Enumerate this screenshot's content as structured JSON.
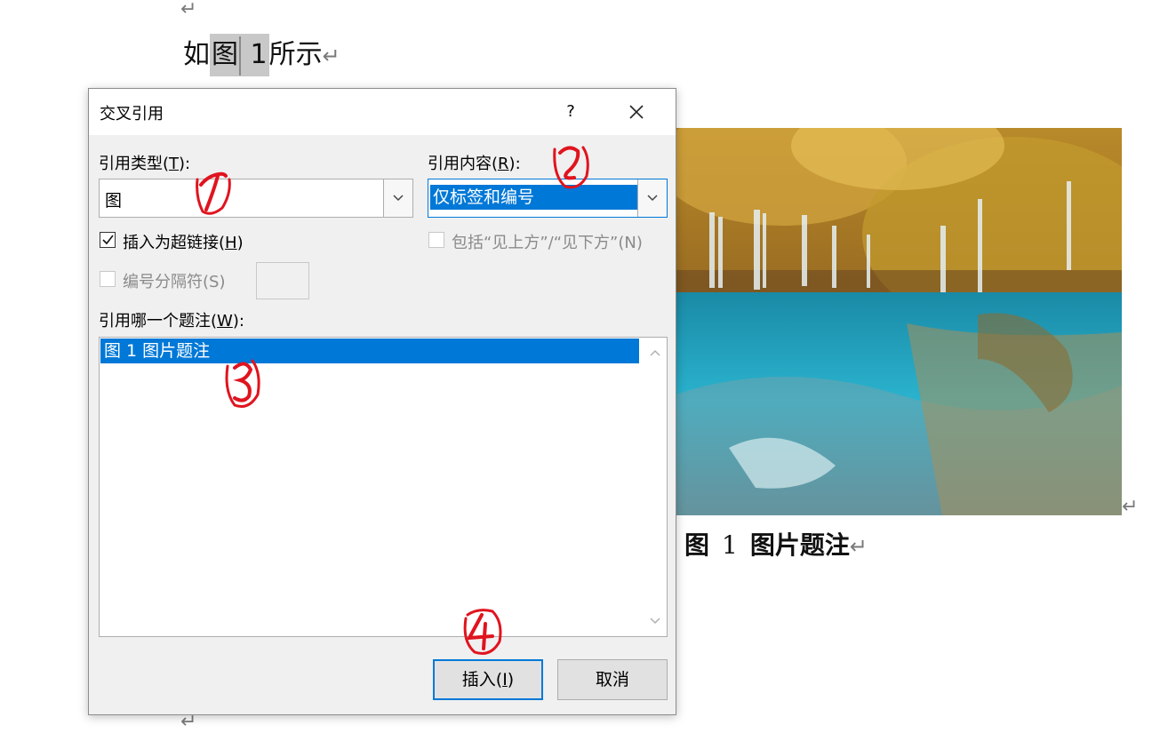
{
  "document": {
    "line_prefix": "如",
    "field_label": "图",
    "field_number": "1",
    "line_suffix": "所示",
    "caption_label": "图",
    "caption_number": "1",
    "caption_text": "图片题注"
  },
  "dialog": {
    "title": "交叉引用",
    "help": "?",
    "reference_type_label": "引用类型(",
    "reference_type_key": "T",
    "reference_type_end": "):",
    "reference_type_value": "图",
    "reference_content_label": "引用内容(",
    "reference_content_key": "R",
    "reference_content_end": "):",
    "reference_content_value": "仅标签和编号",
    "insert_hyperlink_label": "插入为超链接(",
    "insert_hyperlink_key": "H",
    "insert_hyperlink_end": ")",
    "insert_hyperlink_checked": true,
    "include_above_below_label": "包括“见上方”/“见下方”(N)",
    "number_separator_label": "编号分隔符(S)",
    "which_caption_label": "引用哪一个题注(",
    "which_caption_key": "W",
    "which_caption_end": "):",
    "captions": [
      "图 1 图片题注"
    ],
    "insert_button_prefix": "插入(",
    "insert_button_key": "I",
    "insert_button_end": ")",
    "cancel_button": "取消"
  },
  "annotations": [
    "1",
    "2",
    "3",
    "4"
  ],
  "colors": {
    "selection": "#0078d7",
    "annotation": "#e0141e"
  },
  "icons": [
    "paragraph-mark-icon",
    "close-icon",
    "chevron-down-icon",
    "check-icon",
    "scroll-up-icon",
    "scroll-down-icon"
  ]
}
